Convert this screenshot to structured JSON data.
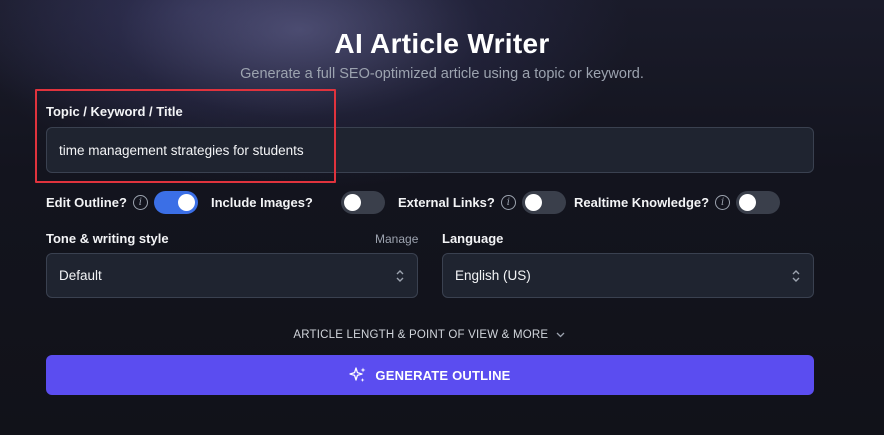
{
  "header": {
    "title": "AI Article Writer",
    "subtitle": "Generate a full SEO-optimized article using a topic or keyword."
  },
  "topic": {
    "label": "Topic / Keyword / Title",
    "value": "time management strategies for students"
  },
  "options": [
    {
      "label": "Edit Outline?",
      "on": true
    },
    {
      "label": "Include Images?",
      "on": false
    },
    {
      "label": "External Links?",
      "on": false
    },
    {
      "label": "Realtime Knowledge?",
      "on": false
    }
  ],
  "info_glyph": "i",
  "tone": {
    "label": "Tone & writing style",
    "manage_label": "Manage",
    "value": "Default"
  },
  "language": {
    "label": "Language",
    "value": "English (US)"
  },
  "more_label": "ARTICLE LENGTH & POINT OF VIEW & MORE",
  "generate_label": "GENERATE OUTLINE",
  "colors": {
    "accent": "#5b4df0",
    "toggle_on": "#3b6fe6",
    "highlight": "#e0333d"
  },
  "icons": {
    "generate": "sparkles-icon",
    "info": "info-icon",
    "more": "chevron-down-icon",
    "select": "chevron-up-down-icon"
  }
}
